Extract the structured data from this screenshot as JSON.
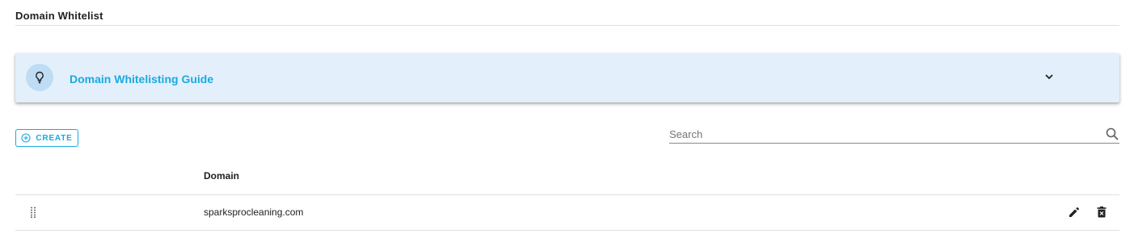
{
  "page": {
    "title": "Domain Whitelist"
  },
  "guide": {
    "title": "Domain Whitelisting Guide",
    "icon": "lightbulb-icon",
    "expand_icon": "chevron-down-icon"
  },
  "toolbar": {
    "create_label": "CREATE",
    "create_icon": "add-circle-icon"
  },
  "search": {
    "placeholder": "Search",
    "value": "",
    "icon": "search-icon"
  },
  "table": {
    "columns": [
      "Domain"
    ],
    "rows": [
      {
        "domain": "sparksprocleaning.com"
      }
    ],
    "row_actions": [
      "edit-icon",
      "delete-icon"
    ]
  },
  "colors": {
    "accent": "#1aa9e0",
    "guide_background": "#e3f0fb",
    "bulb_circle": "#bfdcf5"
  }
}
